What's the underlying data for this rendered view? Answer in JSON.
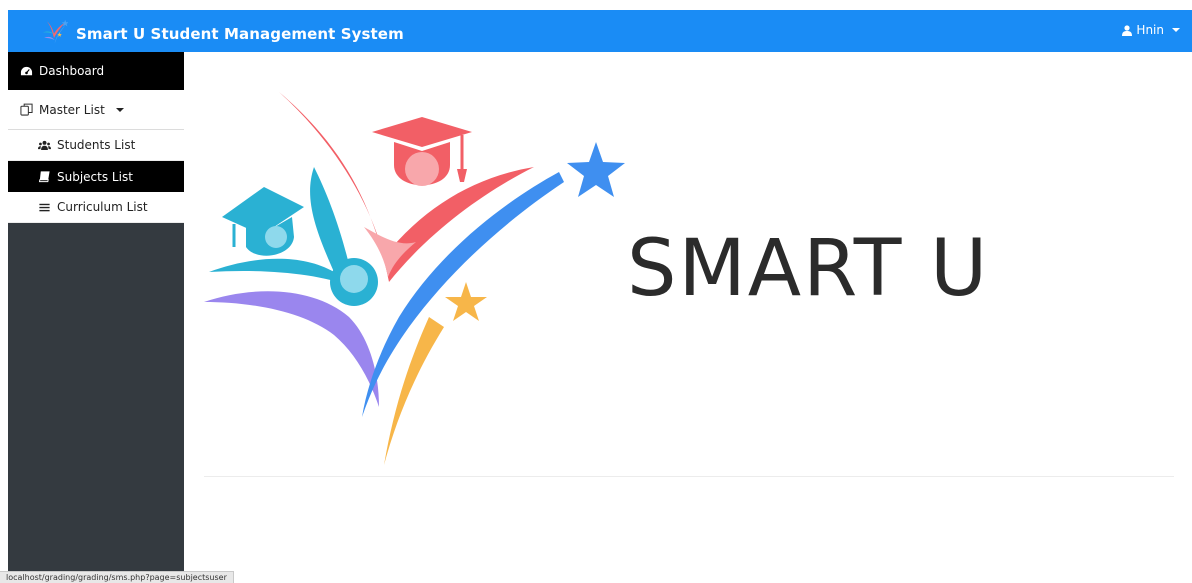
{
  "app": {
    "title": "Smart U Student Management System"
  },
  "user_menu": {
    "name": "Hnin"
  },
  "sidebar": {
    "items": [
      {
        "label": "Dashboard",
        "icon": "dashboard-icon"
      },
      {
        "label": "Master List",
        "icon": "copy-icon"
      },
      {
        "label": "Students List",
        "icon": "users-icon"
      },
      {
        "label": "Subjects List",
        "icon": "book-icon"
      },
      {
        "label": "Curriculum List",
        "icon": "list-icon"
      }
    ]
  },
  "main": {
    "hero_title": "SMART U"
  },
  "status_bar": {
    "url": "localhost/grading/grading/sms.php?page=subjectsuser"
  },
  "colors": {
    "navbar": "#1a8cf5",
    "sidebar": "#343a40",
    "active": "#000000"
  }
}
